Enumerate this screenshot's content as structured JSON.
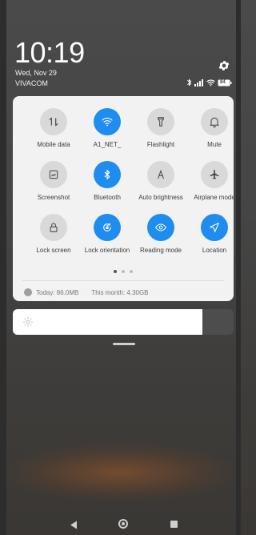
{
  "status": {
    "time": "10:19",
    "date": "Wed, Nov 29",
    "carrier": "VIVACOM",
    "battery": "84",
    "icons": [
      "bluetooth-icon",
      "cellular-signal-icon",
      "wifi-icon",
      "battery-icon"
    ]
  },
  "quick_settings": {
    "tiles": [
      {
        "label": "Mobile data",
        "icon": "mobile-data-icon",
        "active": false
      },
      {
        "label": "A1_NET_",
        "icon": "wifi-icon",
        "active": true
      },
      {
        "label": "Flashlight",
        "icon": "flashlight-icon",
        "active": false
      },
      {
        "label": "Mute",
        "icon": "bell-icon",
        "active": false
      },
      {
        "label": "Screenshot",
        "icon": "screenshot-icon",
        "active": false
      },
      {
        "label": "Bluetooth",
        "icon": "bluetooth-icon",
        "active": true
      },
      {
        "label": "Auto brightness",
        "icon": "auto-brightness-icon",
        "active": false
      },
      {
        "label": "Airplane mode",
        "icon": "airplane-icon",
        "active": false
      },
      {
        "label": "Lock screen",
        "icon": "lock-icon",
        "active": false
      },
      {
        "label": "Lock orientation",
        "icon": "rotation-lock-icon",
        "active": true
      },
      {
        "label": "Reading mode",
        "icon": "eye-icon",
        "active": true
      },
      {
        "label": "Location",
        "icon": "location-icon",
        "active": true
      }
    ],
    "page_count": 3,
    "current_page": 1
  },
  "data_usage": {
    "today": "Today: 86.0MB",
    "month": "This month: 4.30GB"
  },
  "brightness": {
    "level": 0.86
  },
  "colors": {
    "accent": "#1f8cf0",
    "panel": "#f2f2f2",
    "tile_off": "#d9d9d9"
  }
}
